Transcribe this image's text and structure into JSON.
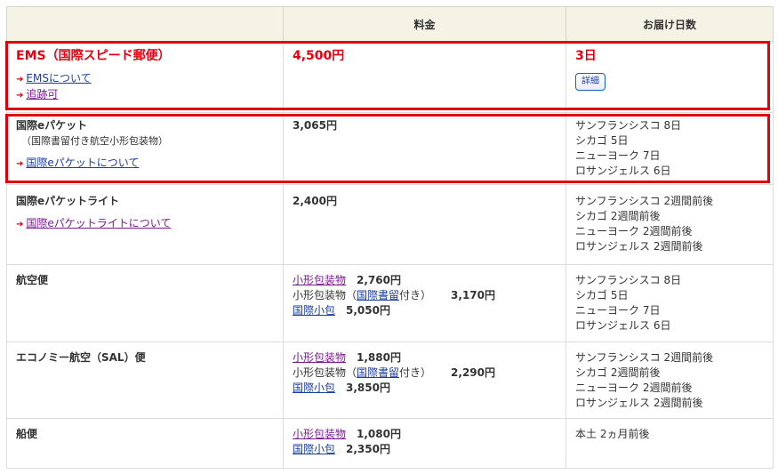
{
  "header": {
    "col1": "",
    "col2": "料金",
    "col3": "お届け日数"
  },
  "ems": {
    "name": "EMS（国際スピード郵便）",
    "price": "4,500円",
    "days": "3日",
    "links": [
      "EMSについて",
      "追跡可"
    ],
    "detail_button": "詳細"
  },
  "epacket": {
    "name": "国際eパケット",
    "sub": "（国際書留付き航空小形包装物）",
    "link": "国際eパケットについて",
    "price": "3,065円",
    "days": [
      "サンフランシスコ 8日",
      "シカゴ 5日",
      "ニューヨーク 7日",
      "ロサンジェルス 6日"
    ]
  },
  "epacket_lite": {
    "name": "国際eパケットライト",
    "link": "国際eパケットライトについて",
    "price": "2,400円",
    "days": [
      "サンフランシスコ 2週間前後",
      "シカゴ 2週間前後",
      "ニューヨーク 2週間前後",
      "ロサンジェルス 2週間前後"
    ]
  },
  "air": {
    "name": "航空便",
    "prices": {
      "small_packet_link": "小形包装物",
      "small_packet_amt": "2,760円",
      "registered_prefix": "小形包装物（",
      "registered_link": "国際書留",
      "registered_suffix": "付き）",
      "registered_amt": "3,170円",
      "parcel_link": "国際小包",
      "parcel_amt": "5,050円"
    },
    "days": [
      "サンフランシスコ 8日",
      "シカゴ 5日",
      "ニューヨーク 7日",
      "ロサンジェルス 6日"
    ]
  },
  "sal": {
    "name": "エコノミー航空（SAL）便",
    "prices": {
      "small_packet_link": "小形包装物",
      "small_packet_amt": "1,880円",
      "registered_prefix": "小形包装物（",
      "registered_link": "国際書留",
      "registered_suffix": "付き）",
      "registered_amt": "2,290円",
      "parcel_link": "国際小包",
      "parcel_amt": "3,850円"
    },
    "days": [
      "サンフランシスコ 2週間前後",
      "シカゴ 2週間前後",
      "ニューヨーク 2週間前後",
      "ロサンジェルス 2週間前後"
    ]
  },
  "ship": {
    "name": "船便",
    "prices": {
      "small_packet_link": "小形包装物",
      "small_packet_amt": "1,080円",
      "parcel_link": "国際小包",
      "parcel_amt": "2,350円"
    },
    "days": "本土 2ヵ月前後"
  },
  "colors": {
    "accent_red": "#e60012",
    "link_blue": "#1b3f9e",
    "link_purple": "#7a1c8f",
    "header_bg": "#f5f2e6"
  }
}
